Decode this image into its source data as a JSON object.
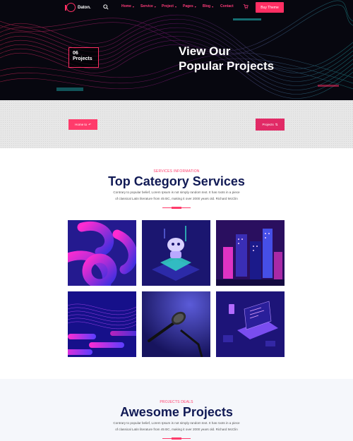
{
  "header": {
    "logo_text": "Daton.",
    "menu": [
      {
        "label": "Home"
      },
      {
        "label": "Service"
      },
      {
        "label": "Project"
      },
      {
        "label": "Pages"
      },
      {
        "label": "Blog"
      },
      {
        "label": "Contact"
      }
    ],
    "buy_label": "Buy Theme"
  },
  "hero": {
    "badge_number": "06",
    "badge_label": "Projects",
    "title_line1": "View Our",
    "title_line2": "Popular Projects"
  },
  "breadcrumb": {
    "home_label": "Home to",
    "current_label": "Projects"
  },
  "services": {
    "eyebrow": "SERVICES INFORMATION",
    "title": "Top Category Services",
    "text_line1": "Contrary to popular belief, Lorem Ipsum is not simply random text. It has roots in a piece",
    "text_line2": "of classical Latin literature from 45 BC, making it over 2000 years old. Richard McClin"
  },
  "projects": {
    "eyebrow": "PROJECTS DEALS",
    "title": "Awesome Projects",
    "text_line1": "Contrary to popular belief, Lorem Ipsum is not simply random text. It has roots in a piece",
    "text_line2": "of classical Latin literature from 45 BC, making it over 2000 years old. Richard McClin"
  },
  "icons": {
    "search": "search-icon",
    "cart": "cart-icon",
    "chevron": "chevron-down-icon",
    "arrow": "arrow-icon"
  },
  "colors": {
    "accent": "#ff2e63",
    "navy": "#111a55",
    "hero_bg": "#07070f"
  }
}
